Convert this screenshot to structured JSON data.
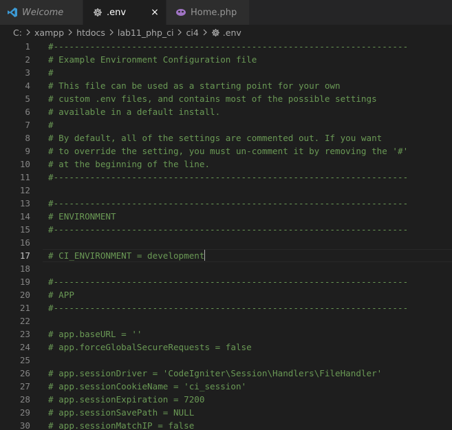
{
  "tabs": [
    {
      "label": "Welcome",
      "icon": "vscode-icon",
      "active": false
    },
    {
      "label": ".env",
      "icon": "gear-icon",
      "active": true,
      "close": "×"
    },
    {
      "label": "Home.php",
      "icon": "php-icon",
      "active": false
    }
  ],
  "breadcrumb": [
    "C:",
    "xampp",
    "htdocs",
    "lab11_php_ci",
    "ci4",
    ".env"
  ],
  "editor": {
    "current_line": 17,
    "lines": [
      {
        "n": "1",
        "text": "#--------------------------------------------------------------------"
      },
      {
        "n": "2",
        "text": "# Example Environment Configuration file"
      },
      {
        "n": "3",
        "text": "#"
      },
      {
        "n": "4",
        "text": "# This file can be used as a starting point for your own"
      },
      {
        "n": "5",
        "text": "# custom .env files, and contains most of the possible settings"
      },
      {
        "n": "6",
        "text": "# available in a default install."
      },
      {
        "n": "7",
        "text": "#"
      },
      {
        "n": "8",
        "text": "# By default, all of the settings are commented out. If you want"
      },
      {
        "n": "9",
        "text": "# to override the setting, you must un-comment it by removing the '#'"
      },
      {
        "n": "10",
        "text": "# at the beginning of the line."
      },
      {
        "n": "11",
        "text": "#--------------------------------------------------------------------"
      },
      {
        "n": "12",
        "text": ""
      },
      {
        "n": "13",
        "text": "#--------------------------------------------------------------------"
      },
      {
        "n": "14",
        "text": "# ENVIRONMENT"
      },
      {
        "n": "15",
        "text": "#--------------------------------------------------------------------"
      },
      {
        "n": "16",
        "text": ""
      },
      {
        "n": "17",
        "text": "# CI_ENVIRONMENT = development"
      },
      {
        "n": "18",
        "text": ""
      },
      {
        "n": "19",
        "text": "#--------------------------------------------------------------------"
      },
      {
        "n": "20",
        "text": "# APP"
      },
      {
        "n": "21",
        "text": "#--------------------------------------------------------------------"
      },
      {
        "n": "22",
        "text": ""
      },
      {
        "n": "23",
        "text": "# app.baseURL = ''"
      },
      {
        "n": "24",
        "text": "# app.forceGlobalSecureRequests = false"
      },
      {
        "n": "25",
        "text": ""
      },
      {
        "n": "26",
        "text": "# app.sessionDriver = 'CodeIgniter\\Session\\Handlers\\FileHandler'"
      },
      {
        "n": "27",
        "text": "# app.sessionCookieName = 'ci_session'"
      },
      {
        "n": "28",
        "text": "# app.sessionExpiration = 7200"
      },
      {
        "n": "29",
        "text": "# app.sessionSavePath = NULL"
      },
      {
        "n": "30",
        "text": "# app.sessionMatchIP = false"
      }
    ]
  },
  "colors": {
    "background": "#1e1e1e",
    "comment": "#6a9955",
    "line_number": "#858585",
    "tab_inactive": "#2d2d2d",
    "php_icon": "#a074c4",
    "vscode_icon": "#3c99d4"
  }
}
